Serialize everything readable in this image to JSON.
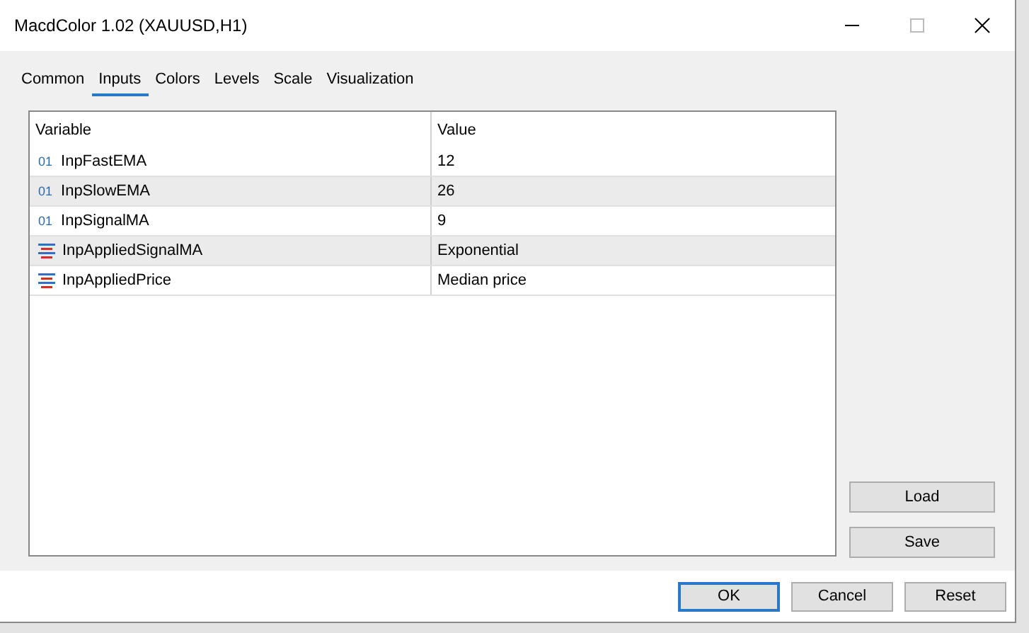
{
  "window": {
    "title": "MacdColor 1.02 (XAUUSD,H1)"
  },
  "tabs": [
    {
      "label": "Common",
      "selected": false
    },
    {
      "label": "Inputs",
      "selected": true
    },
    {
      "label": "Colors",
      "selected": false
    },
    {
      "label": "Levels",
      "selected": false
    },
    {
      "label": "Scale",
      "selected": false
    },
    {
      "label": "Visualization",
      "selected": false
    }
  ],
  "table": {
    "columns": [
      "Variable",
      "Value"
    ],
    "rows": [
      {
        "kind": "integer",
        "icon_text": "01",
        "variable": "InpFastEMA",
        "value": "12"
      },
      {
        "kind": "integer",
        "icon_text": "01",
        "variable": "InpSlowEMA",
        "value": "26"
      },
      {
        "kind": "integer",
        "icon_text": "01",
        "variable": "InpSignalMA",
        "value": "9"
      },
      {
        "kind": "enum",
        "variable": "InpAppliedSignalMA",
        "value": "Exponential"
      },
      {
        "kind": "enum",
        "variable": "InpAppliedPrice",
        "value": "Median price"
      }
    ]
  },
  "side_buttons": [
    "Load",
    "Save"
  ],
  "buttons": [
    {
      "label": "OK",
      "default": true
    },
    {
      "label": "Cancel",
      "default": false
    },
    {
      "label": "Reset",
      "default": false
    }
  ]
}
